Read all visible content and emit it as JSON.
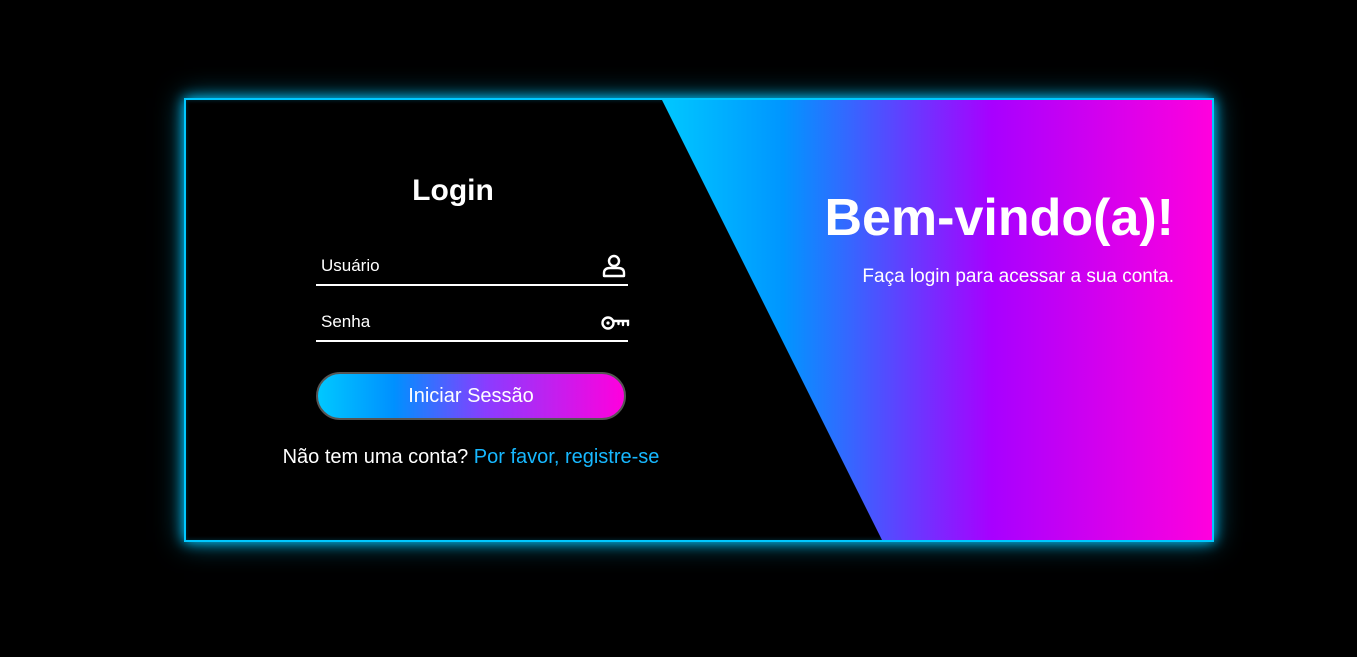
{
  "login": {
    "title": "Login",
    "username": {
      "placeholder": "Usuário",
      "value": "",
      "icon": "user-icon"
    },
    "password": {
      "placeholder": "Senha",
      "value": "",
      "icon": "key-icon"
    },
    "submit_label": "Iniciar Sessão",
    "signup_prompt": "Não tem uma conta?",
    "signup_link": "Por favor, registre-se"
  },
  "welcome": {
    "title": "Bem-vindo(a)!",
    "subtitle": "Faça login para acessar a sua conta."
  },
  "colors": {
    "background": "#000000",
    "neon_border": "#00c8ff",
    "gradient_start": "#00c8ff",
    "gradient_mid": "#a800ff",
    "gradient_end": "#ff00dd",
    "link": "#17b8ff",
    "text": "#ffffff"
  }
}
